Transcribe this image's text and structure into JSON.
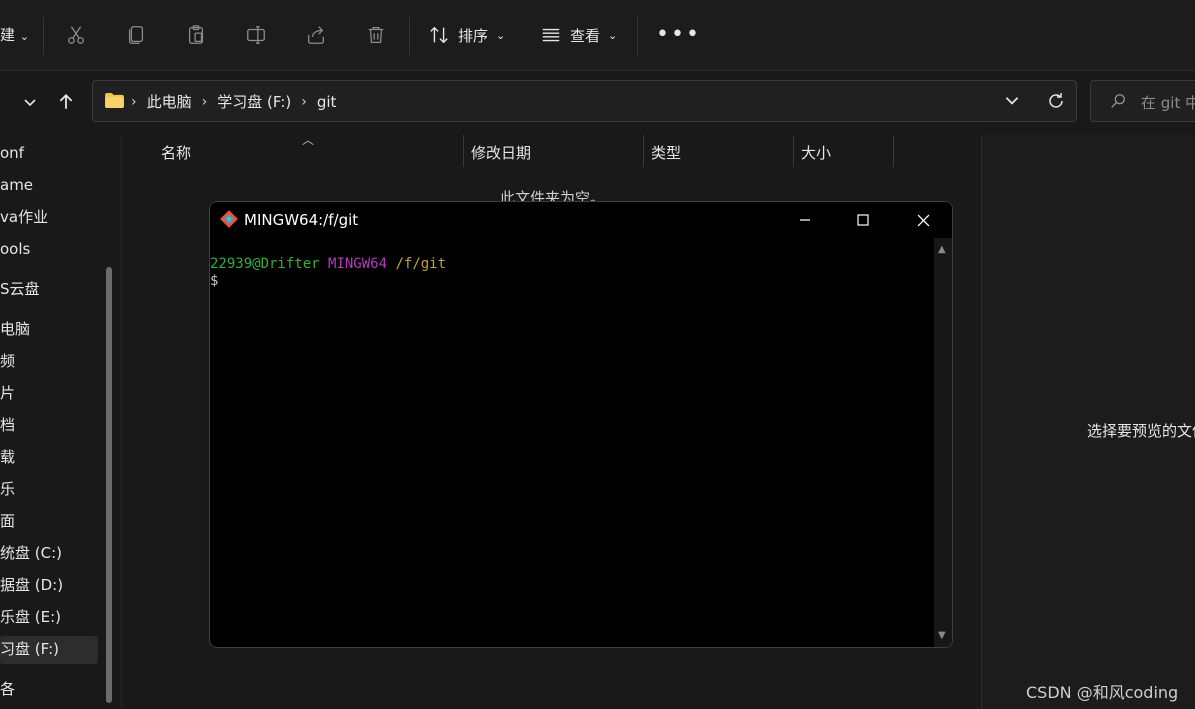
{
  "toolbar": {
    "new_label": "建",
    "sort_label": "排序",
    "view_label": "查看",
    "more_label": "•••"
  },
  "address": {
    "crumbs": [
      "此电脑",
      "学习盘 (F:)",
      "git"
    ],
    "search_placeholder": "在 git 中"
  },
  "sidebar": {
    "items": [
      "onf",
      "ame",
      "va作业",
      "ools",
      "S云盘",
      "电脑",
      "频",
      "片",
      "档",
      "载",
      "乐",
      "面",
      "统盘 (C:)",
      "据盘 (D:)",
      "乐盘 (E:)",
      "习盘 (F:)",
      "各"
    ]
  },
  "file_list": {
    "columns": [
      "名称",
      "修改日期",
      "类型",
      "大小"
    ],
    "empty_message": "此文件夹为空。"
  },
  "preview": {
    "message": "选择要预览的文件"
  },
  "terminal": {
    "title": "MINGW64:/f/git",
    "prompt_user": "22939@Drifter",
    "prompt_system": "MINGW64",
    "prompt_path": "/f/git",
    "prompt_symbol": "$"
  },
  "watermark": "CSDN @和风coding",
  "colors": {
    "terminal_user": "#30b03a",
    "terminal_system": "#b23bbd",
    "terminal_path": "#c2a23a",
    "folder": "#f2c34c"
  }
}
